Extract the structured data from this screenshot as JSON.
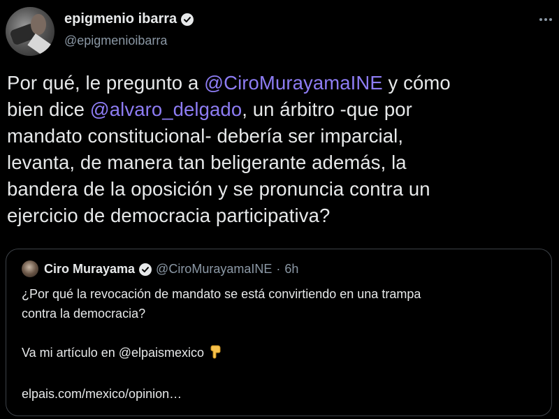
{
  "author": {
    "display_name": "epigmenio ibarra",
    "handle": "@epigmenioibarra",
    "verified": true
  },
  "tweet": {
    "line1_pre": "Por qué, le pregunto a ",
    "line1_mention": "@CiroMurayamaINE",
    "line1_post": " y cómo",
    "line2_pre": "bien dice ",
    "line2_mention": "@alvaro_delgado",
    "line2_post": ", un árbitro -que por",
    "line3": "mandato constitucional- debería ser imparcial,",
    "line4": "levanta, de manera tan beligerante además, la",
    "line5": "bandera de la oposición y se pronuncia contra un",
    "line6": "ejercicio de democracia participativa?"
  },
  "quote": {
    "display_name": "Ciro Murayama",
    "verified": true,
    "handle": "@CiroMurayamaINE",
    "separator": "·",
    "time": "6h",
    "line1": "¿Por qué la revocación de mandato se está convirtiendo en una trampa",
    "line2": "contra la democracia?",
    "line3": "Va mi artículo en @elpaismexico",
    "link": "elpais.com/mexico/opinion…",
    "emoji_icon": "pointing-down-hand-icon"
  },
  "colors": {
    "background": "#000000",
    "text": "#e7e9ea",
    "secondary": "#8b98a5",
    "mention": "#8d7cf3",
    "border": "#3d4248"
  }
}
